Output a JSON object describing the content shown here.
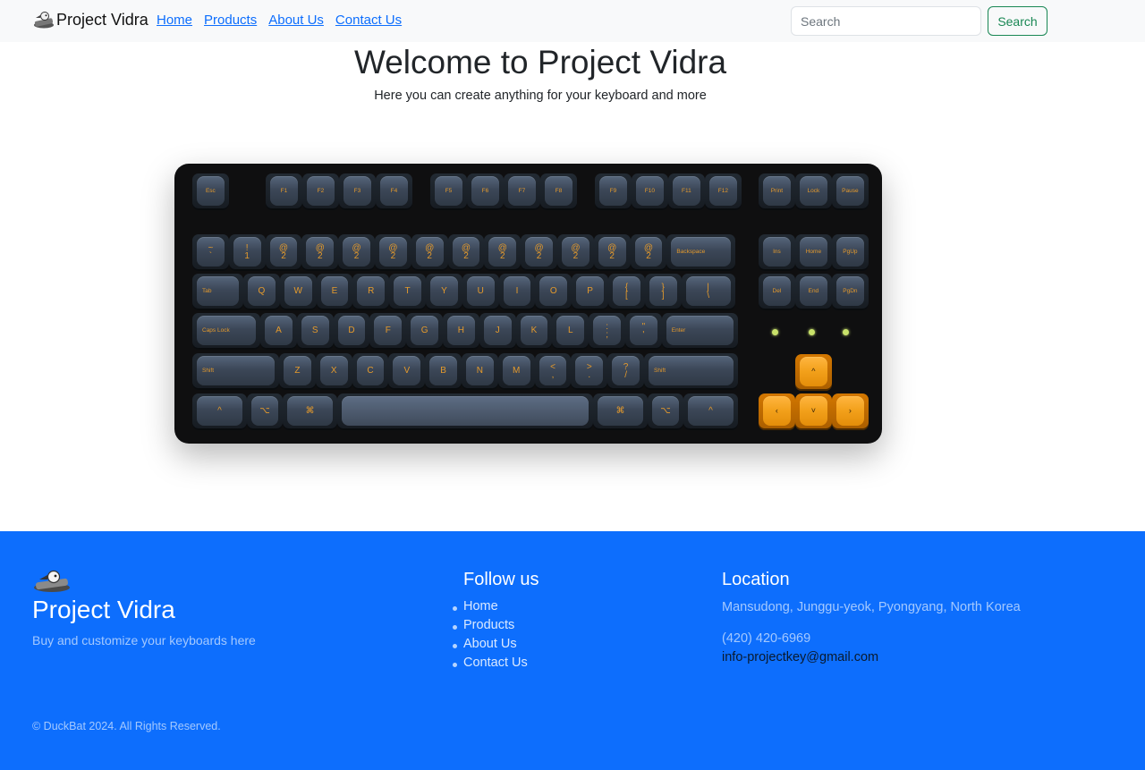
{
  "colors": {
    "accent": "#0d6efd",
    "search_button": "#198754",
    "key_legend": "#e49a2c",
    "key_highlight": "#f2a01a"
  },
  "navbar": {
    "brand": "Project Vidra",
    "logo_icon": "keyboard-mascot-icon",
    "links": [
      "Home",
      "Products",
      "About Us",
      "Contact Us"
    ],
    "search_placeholder": "Search",
    "search_button": "Search"
  },
  "hero": {
    "title": "Welcome to Project Vidra",
    "subtitle": "Here you can create anything for your keyboard and more"
  },
  "keyboard": {
    "function_row": [
      "Esc",
      "F1",
      "F2",
      "F3",
      "F4",
      "F5",
      "F6",
      "F7",
      "F8",
      "F9",
      "F10",
      "F11",
      "F12",
      "Print",
      "Lock",
      "Pause"
    ],
    "number_row": [
      "~\n`",
      "!\n1",
      "@\n2",
      "@\n2",
      "@\n2",
      "@\n2",
      "@\n2",
      "@\n2",
      "@\n2",
      "@\n2",
      "@\n2",
      "@\n2",
      "@\n2",
      "Backspace"
    ],
    "qwerty_row": [
      "Tab",
      "Q",
      "W",
      "E",
      "R",
      "T",
      "Y",
      "U",
      "I",
      "O",
      "P",
      "{\n[",
      "}\n]",
      "|\n\\"
    ],
    "home_row": [
      "Caps Lock",
      "A",
      "S",
      "D",
      "F",
      "G",
      "H",
      "J",
      "K",
      "L",
      ":\n;",
      "\"\n'",
      "Enter"
    ],
    "shift_row": [
      "Shift",
      "Z",
      "X",
      "C",
      "V",
      "B",
      "N",
      "M",
      "<\n,",
      ">\n.",
      "?\n/",
      "Shift"
    ],
    "bottom_row": [
      "^",
      "⌥",
      "⌘",
      "",
      "⌘",
      "⌥",
      "^"
    ],
    "nav_cluster": [
      "Ins",
      "Home",
      "PgUp",
      "Del",
      "End",
      "PgDn"
    ],
    "arrows": [
      "^",
      "‹",
      "˅",
      "›"
    ]
  },
  "footer": {
    "logo_icon": "keyboard-mascot-icon",
    "brand": "Project Vidra",
    "tagline": "Buy and customize your keyboards here",
    "follow_heading": "Follow us",
    "links": [
      "Home",
      "Products",
      "About Us",
      "Contact Us"
    ],
    "location_heading": "Location",
    "address": "Mansudong, Junggu-yeok, Pyongyang, North Korea",
    "phone": "(420) 420-6969",
    "email": "info-projectkey@gmail.com",
    "copyright": "© DuckBat 2024. All Rights Reserved."
  }
}
